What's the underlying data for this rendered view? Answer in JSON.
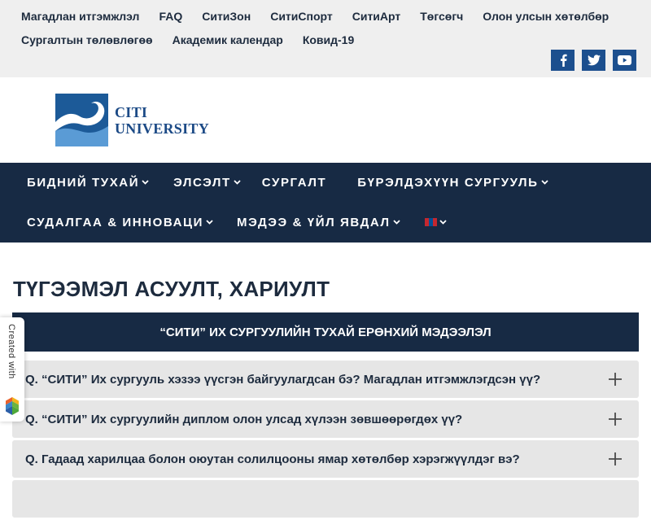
{
  "topbar": {
    "links": [
      "Магадлан итгэмжлэл",
      "FAQ",
      "СитиЗон",
      "СитиСпорт",
      "СитиАрт",
      "Төгсөгч",
      "Олон улсын хөтөлбөр",
      "Сургалтын төлөвлөгөө",
      "Академик календар",
      "Ковид-19"
    ],
    "social": [
      "facebook-icon",
      "twitter-icon",
      "youtube-icon"
    ]
  },
  "logo": {
    "line1": "CITI",
    "line2": "UNIVERSITY"
  },
  "nav": {
    "items": [
      {
        "label": "БИДНИЙ ТУХАЙ",
        "dropdown": true
      },
      {
        "label": "ЭЛСЭЛТ",
        "dropdown": true
      },
      {
        "label": "СУРГАЛТ",
        "dropdown": false
      },
      {
        "label": "БҮРЭЛДЭХҮҮН СУРГУУЛЬ",
        "dropdown": true
      },
      {
        "label": "СУДАЛГАА & ИННОВАЦИ",
        "dropdown": true
      },
      {
        "label": "МЭДЭЭ & ҮЙЛ ЯВДАЛ",
        "dropdown": true
      }
    ],
    "language": "mongolian-flag-icon"
  },
  "page": {
    "title": "ТҮГЭЭМЭЛ АСУУЛТ, ХАРИУЛТ",
    "section_header": "“СИТИ” ИХ СУРГУУЛИЙН ТУХАЙ ЕРӨНХИЙ МЭДЭЭЛЭЛ",
    "faq": [
      "Q. “СИТИ” Их сургууль хэзээ үүсгэн байгуулагдсан бэ? Магадлан итгэмжлэгдсэн үү?",
      "Q. “СИТИ” Их сургуулийн диплом олон улсад хүлээн зөвшөөрөгдөх үү?",
      "Q. Гадаад харилцаа болон оюутан солилцооны ямар хөтөлбөр хэрэгжүүлдэг вэ?"
    ]
  },
  "badge": {
    "text": "Created with"
  },
  "colors": {
    "navy": "#172a44",
    "brand_blue": "#1c4f8e",
    "faq_bg": "#e6e6e6",
    "topbar_bg": "#efefef"
  }
}
